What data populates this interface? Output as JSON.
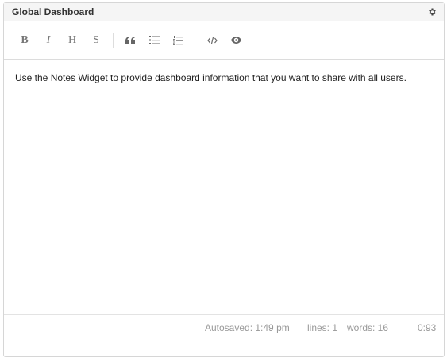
{
  "widget": {
    "title": "Global Dashboard"
  },
  "toolbar": {
    "bold_label": "B",
    "italic_label": "I",
    "heading_label": "H",
    "strike_label": "S",
    "icons": [
      "bold-icon",
      "italic-icon",
      "heading-icon",
      "strikethrough-icon",
      "quote-icon",
      "unordered-list-icon",
      "ordered-list-icon",
      "code-icon",
      "preview-eye-icon"
    ]
  },
  "editor": {
    "text": "Use the Notes Widget to provide dashboard information that you want to share with all users."
  },
  "status": {
    "autosaved": "Autosaved: 1:49 pm",
    "lines": "lines: 1",
    "words": "words: 16",
    "cursor": "0:93"
  }
}
